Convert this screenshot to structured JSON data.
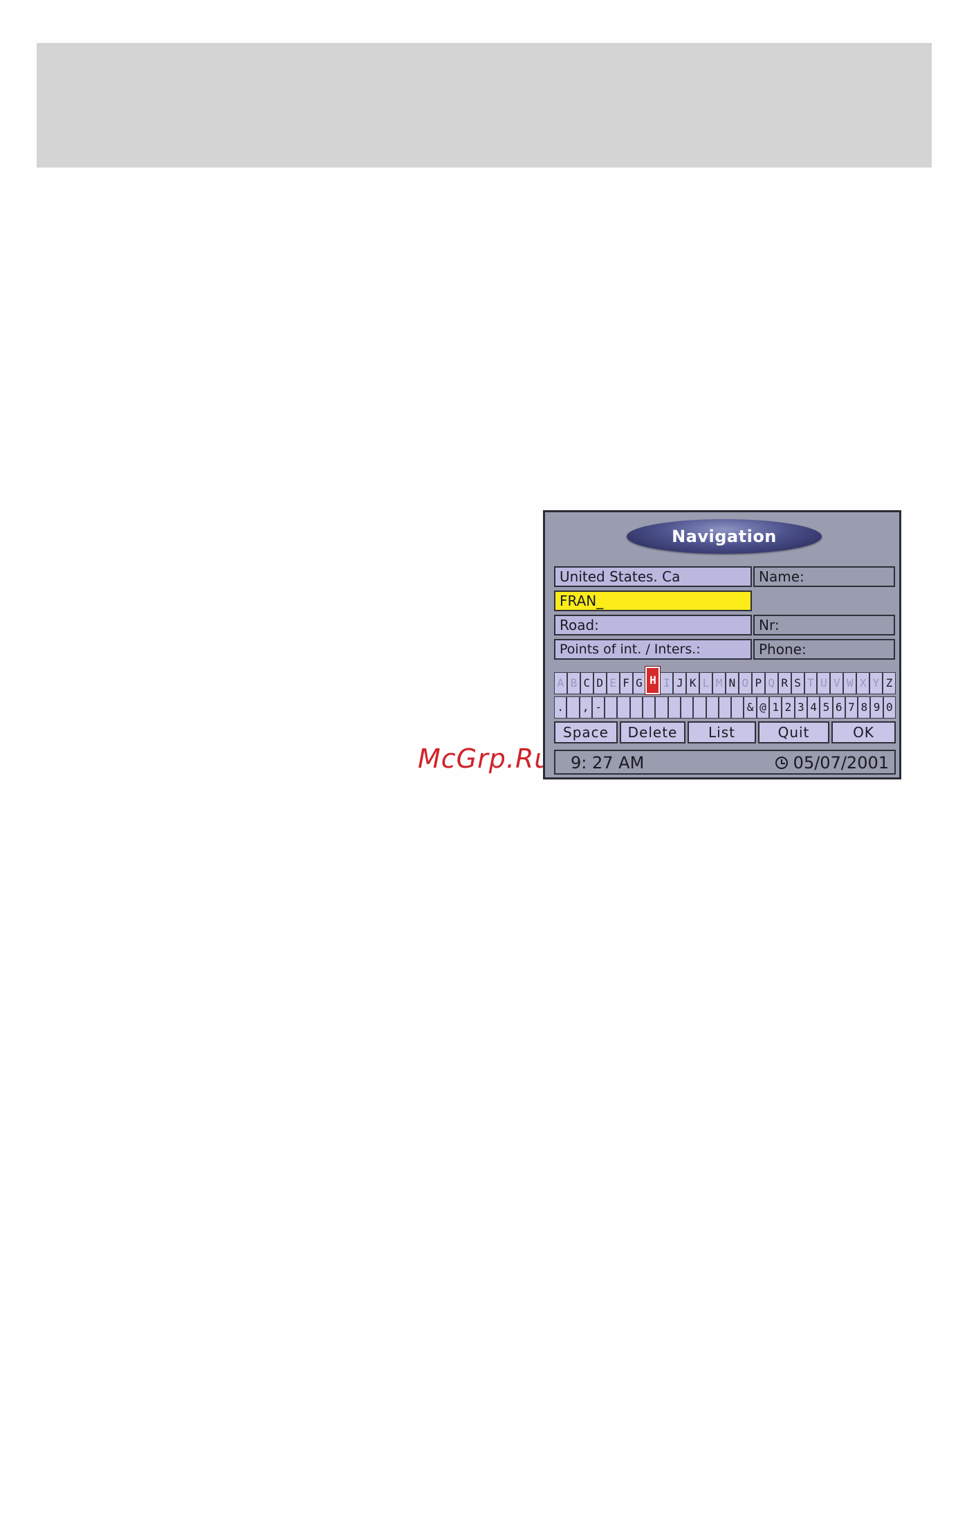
{
  "watermark": "McGrp.Ru",
  "nav": {
    "title": "Navigation",
    "fields_left": [
      "United States. Ca",
      "FRAN_",
      "Road:",
      "Points of int. / Inters.:"
    ],
    "fields_right": [
      "Name:",
      "Nr:",
      "Phone:"
    ],
    "keyboard_row1": [
      "A",
      "B",
      "C",
      "D",
      "E",
      "F",
      "G",
      "H",
      "I",
      "J",
      "K",
      "L",
      "M",
      "N",
      "O",
      "P",
      "Q",
      "R",
      "S",
      "T",
      "U",
      "V",
      "W",
      "X",
      "Y",
      "Z"
    ],
    "keyboard_row1_enabled": [
      false,
      false,
      true,
      true,
      false,
      true,
      true,
      true,
      false,
      true,
      true,
      false,
      false,
      true,
      false,
      true,
      false,
      true,
      true,
      false,
      false,
      false,
      false,
      false,
      false,
      true
    ],
    "selected_key": "H",
    "keyboard_row2": [
      ".",
      "",
      ",",
      "-",
      "",
      "",
      "",
      "",
      "",
      "",
      "",
      "",
      "",
      "",
      "",
      "&",
      "@",
      "1",
      "2",
      "3",
      "4",
      "5",
      "6",
      "7",
      "8",
      "9",
      "0"
    ],
    "buttons": [
      "Space",
      "Delete",
      "List",
      "Quit",
      "OK"
    ],
    "time": "9: 27 AM",
    "date": "05/07/2001"
  }
}
